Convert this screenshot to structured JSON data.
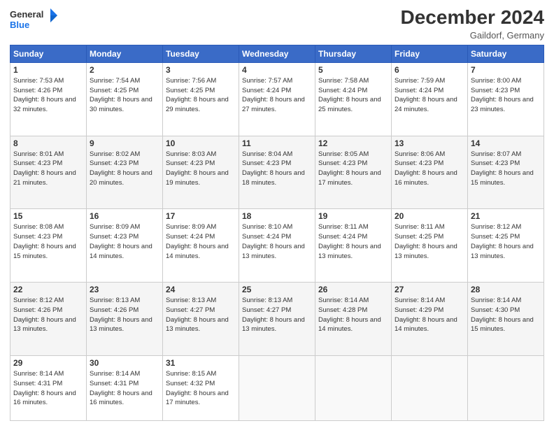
{
  "header": {
    "logo_line1": "General",
    "logo_line2": "Blue",
    "title": "December 2024",
    "subtitle": "Gaildorf, Germany"
  },
  "days_of_week": [
    "Sunday",
    "Monday",
    "Tuesday",
    "Wednesday",
    "Thursday",
    "Friday",
    "Saturday"
  ],
  "weeks": [
    [
      {
        "day": "1",
        "sunrise": "7:53 AM",
        "sunset": "4:26 PM",
        "daylight": "8 hours and 32 minutes."
      },
      {
        "day": "2",
        "sunrise": "7:54 AM",
        "sunset": "4:25 PM",
        "daylight": "8 hours and 30 minutes."
      },
      {
        "day": "3",
        "sunrise": "7:56 AM",
        "sunset": "4:25 PM",
        "daylight": "8 hours and 29 minutes."
      },
      {
        "day": "4",
        "sunrise": "7:57 AM",
        "sunset": "4:24 PM",
        "daylight": "8 hours and 27 minutes."
      },
      {
        "day": "5",
        "sunrise": "7:58 AM",
        "sunset": "4:24 PM",
        "daylight": "8 hours and 25 minutes."
      },
      {
        "day": "6",
        "sunrise": "7:59 AM",
        "sunset": "4:24 PM",
        "daylight": "8 hours and 24 minutes."
      },
      {
        "day": "7",
        "sunrise": "8:00 AM",
        "sunset": "4:23 PM",
        "daylight": "8 hours and 23 minutes."
      }
    ],
    [
      {
        "day": "8",
        "sunrise": "8:01 AM",
        "sunset": "4:23 PM",
        "daylight": "8 hours and 21 minutes."
      },
      {
        "day": "9",
        "sunrise": "8:02 AM",
        "sunset": "4:23 PM",
        "daylight": "8 hours and 20 minutes."
      },
      {
        "day": "10",
        "sunrise": "8:03 AM",
        "sunset": "4:23 PM",
        "daylight": "8 hours and 19 minutes."
      },
      {
        "day": "11",
        "sunrise": "8:04 AM",
        "sunset": "4:23 PM",
        "daylight": "8 hours and 18 minutes."
      },
      {
        "day": "12",
        "sunrise": "8:05 AM",
        "sunset": "4:23 PM",
        "daylight": "8 hours and 17 minutes."
      },
      {
        "day": "13",
        "sunrise": "8:06 AM",
        "sunset": "4:23 PM",
        "daylight": "8 hours and 16 minutes."
      },
      {
        "day": "14",
        "sunrise": "8:07 AM",
        "sunset": "4:23 PM",
        "daylight": "8 hours and 15 minutes."
      }
    ],
    [
      {
        "day": "15",
        "sunrise": "8:08 AM",
        "sunset": "4:23 PM",
        "daylight": "8 hours and 15 minutes."
      },
      {
        "day": "16",
        "sunrise": "8:09 AM",
        "sunset": "4:23 PM",
        "daylight": "8 hours and 14 minutes."
      },
      {
        "day": "17",
        "sunrise": "8:09 AM",
        "sunset": "4:24 PM",
        "daylight": "8 hours and 14 minutes."
      },
      {
        "day": "18",
        "sunrise": "8:10 AM",
        "sunset": "4:24 PM",
        "daylight": "8 hours and 13 minutes."
      },
      {
        "day": "19",
        "sunrise": "8:11 AM",
        "sunset": "4:24 PM",
        "daylight": "8 hours and 13 minutes."
      },
      {
        "day": "20",
        "sunrise": "8:11 AM",
        "sunset": "4:25 PM",
        "daylight": "8 hours and 13 minutes."
      },
      {
        "day": "21",
        "sunrise": "8:12 AM",
        "sunset": "4:25 PM",
        "daylight": "8 hours and 13 minutes."
      }
    ],
    [
      {
        "day": "22",
        "sunrise": "8:12 AM",
        "sunset": "4:26 PM",
        "daylight": "8 hours and 13 minutes."
      },
      {
        "day": "23",
        "sunrise": "8:13 AM",
        "sunset": "4:26 PM",
        "daylight": "8 hours and 13 minutes."
      },
      {
        "day": "24",
        "sunrise": "8:13 AM",
        "sunset": "4:27 PM",
        "daylight": "8 hours and 13 minutes."
      },
      {
        "day": "25",
        "sunrise": "8:13 AM",
        "sunset": "4:27 PM",
        "daylight": "8 hours and 13 minutes."
      },
      {
        "day": "26",
        "sunrise": "8:14 AM",
        "sunset": "4:28 PM",
        "daylight": "8 hours and 14 minutes."
      },
      {
        "day": "27",
        "sunrise": "8:14 AM",
        "sunset": "4:29 PM",
        "daylight": "8 hours and 14 minutes."
      },
      {
        "day": "28",
        "sunrise": "8:14 AM",
        "sunset": "4:30 PM",
        "daylight": "8 hours and 15 minutes."
      }
    ],
    [
      {
        "day": "29",
        "sunrise": "8:14 AM",
        "sunset": "4:31 PM",
        "daylight": "8 hours and 16 minutes."
      },
      {
        "day": "30",
        "sunrise": "8:14 AM",
        "sunset": "4:31 PM",
        "daylight": "8 hours and 16 minutes."
      },
      {
        "day": "31",
        "sunrise": "8:15 AM",
        "sunset": "4:32 PM",
        "daylight": "8 hours and 17 minutes."
      },
      null,
      null,
      null,
      null
    ]
  ]
}
